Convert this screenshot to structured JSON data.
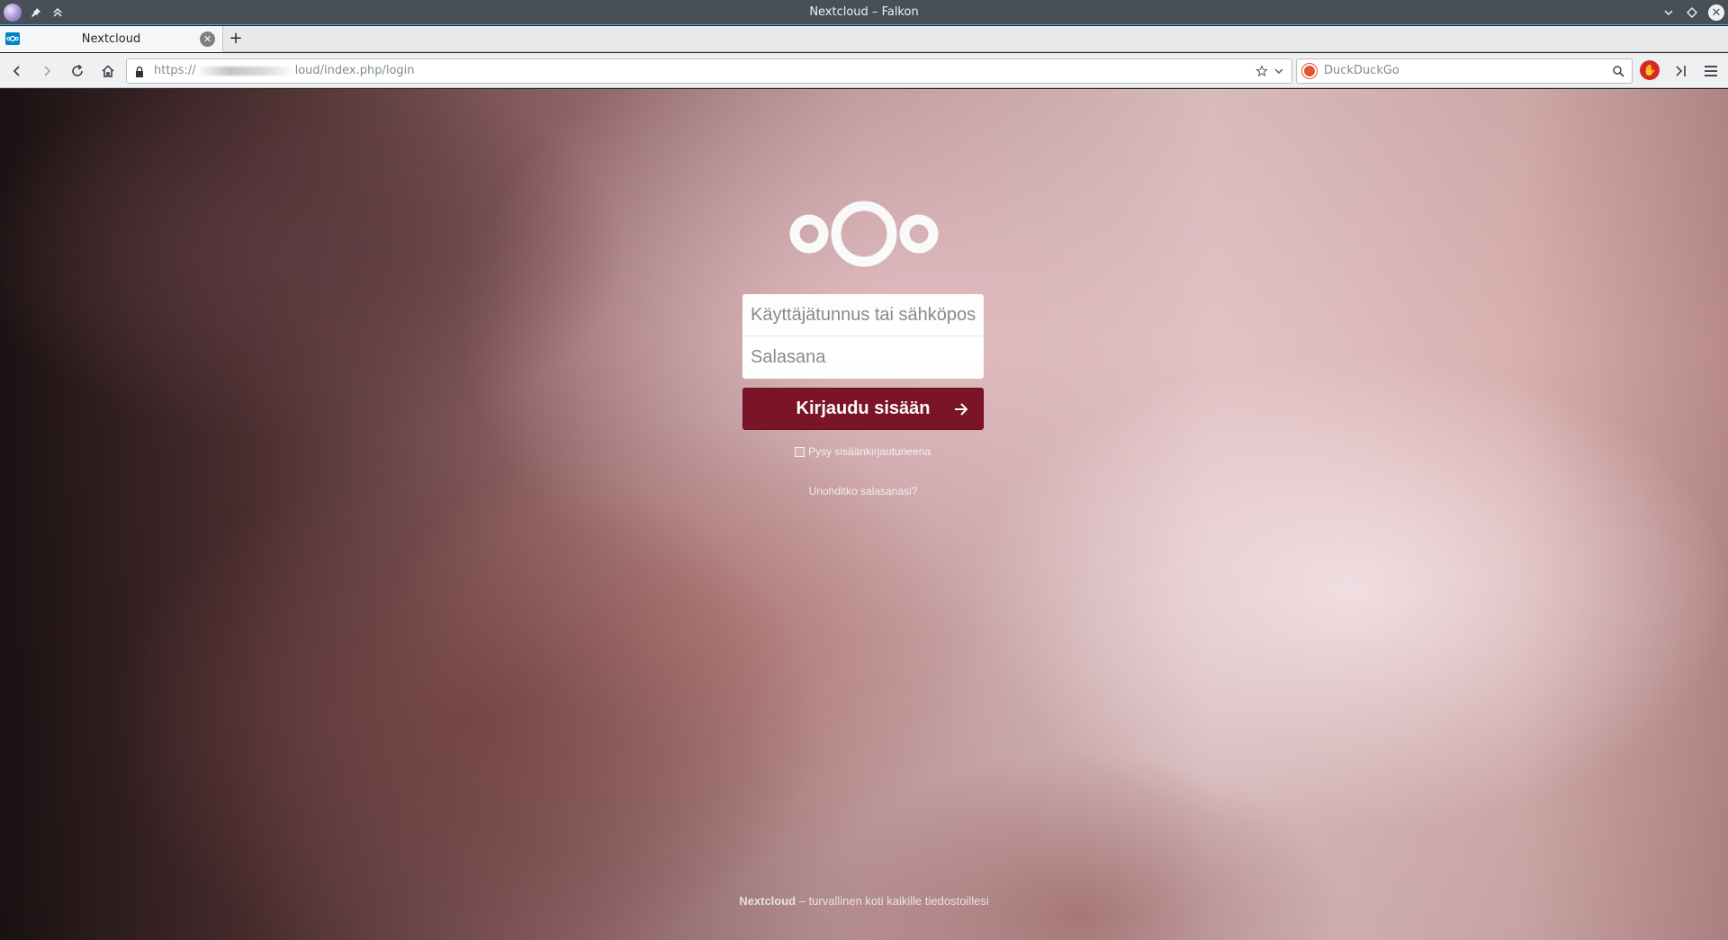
{
  "window": {
    "title": "Nextcloud – Falkon"
  },
  "tabs": [
    {
      "label": "Nextcloud",
      "favicon": "nextcloud-icon",
      "active": true
    }
  ],
  "navbar": {
    "url_prefix": "https://",
    "url_suffix": "loud/index.php/login",
    "search_engine": "DuckDuckGo",
    "search_placeholder": "DuckDuckGo"
  },
  "login": {
    "username_placeholder": "Käyttäjätunnus tai sähköposti",
    "password_placeholder": "Salasana",
    "submit_label": "Kirjaudu sisään",
    "remember_label": "Pysy sisäänkirjautuneena",
    "forgot_label": "Unohditko salasanasi?"
  },
  "footer": {
    "brand": "Nextcloud",
    "tagline": " – turvallinen koti kaikille tiedostoillesi"
  },
  "colors": {
    "accent": "#7d1427",
    "titlebar": "#475057",
    "focus_line": "#3daee9"
  }
}
